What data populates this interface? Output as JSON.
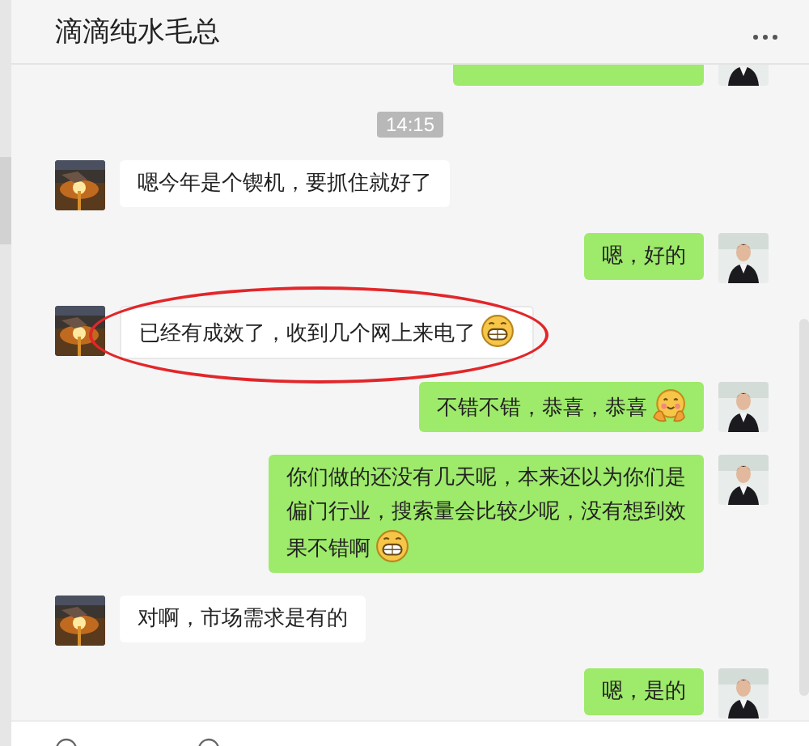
{
  "header": {
    "title": "滴滴纯水毛总"
  },
  "messages": [
    {
      "kind": "partial"
    },
    {
      "kind": "time",
      "text": "14:15"
    },
    {
      "kind": "incoming",
      "parts": [
        {
          "kind": "text",
          "text": "嗯今年是个锲机，要抓住就好了"
        }
      ],
      "highlighted": false
    },
    {
      "kind": "outgoing",
      "parts": [
        {
          "kind": "text",
          "text": "嗯，好的"
        }
      ],
      "highlighted": false
    },
    {
      "kind": "incoming",
      "parts": [
        {
          "kind": "text",
          "text": "已经有成效了，收到几个网上来电了"
        },
        {
          "kind": "grin"
        }
      ],
      "highlighted": true
    },
    {
      "kind": "outgoing",
      "parts": [
        {
          "kind": "text",
          "text": "不错不错，恭喜，恭喜"
        },
        {
          "kind": "hug"
        }
      ],
      "highlighted": false
    },
    {
      "kind": "outgoing",
      "parts": [
        {
          "kind": "text",
          "text": "你们做的还没有几天呢，本来还以为你们是偏门行业，搜索量会比较少呢，没有想到效果不错啊"
        },
        {
          "kind": "grin"
        }
      ],
      "highlighted": false
    },
    {
      "kind": "incoming",
      "parts": [
        {
          "kind": "text",
          "text": "对啊，市场需求是有的"
        }
      ],
      "highlighted": false
    },
    {
      "kind": "outgoing",
      "parts": [
        {
          "kind": "text",
          "text": "嗯，是的"
        }
      ],
      "highlighted": false
    }
  ]
}
